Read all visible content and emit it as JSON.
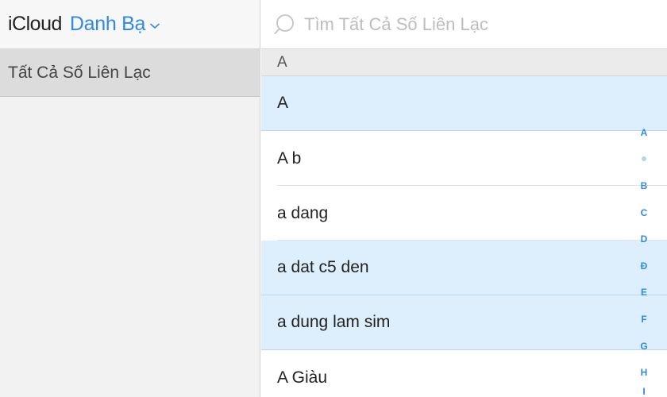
{
  "sidebar": {
    "brand": "iCloud",
    "app_name": "Danh Bạ",
    "groups": [
      {
        "label": "Tất Cả Số Liên Lạc",
        "selected": true
      }
    ]
  },
  "search": {
    "placeholder": "Tìm Tất Cả Số Liên Lạc",
    "value": ""
  },
  "contacts": {
    "section": "A",
    "items": [
      {
        "name": "A",
        "selected": true
      },
      {
        "name": "A b",
        "selected": false
      },
      {
        "name": "a dang",
        "selected": false
      },
      {
        "name": "a dat c5 den",
        "selected": true
      },
      {
        "name": "a dung lam sim",
        "selected": true
      },
      {
        "name": "A Giàu",
        "selected": false
      }
    ]
  },
  "alpha_index": [
    "A",
    "•",
    "B",
    "C",
    "D",
    "Đ",
    "E",
    "F",
    "G",
    "H",
    "I"
  ],
  "colors": {
    "accent": "#2f8ae6",
    "selected_row": "#ddeefc",
    "sidebar_bg": "#f2f2f2",
    "group_selected": "#dcdcdc"
  },
  "icons": {
    "search": "search-icon",
    "chevron": "chevron-down-icon"
  }
}
